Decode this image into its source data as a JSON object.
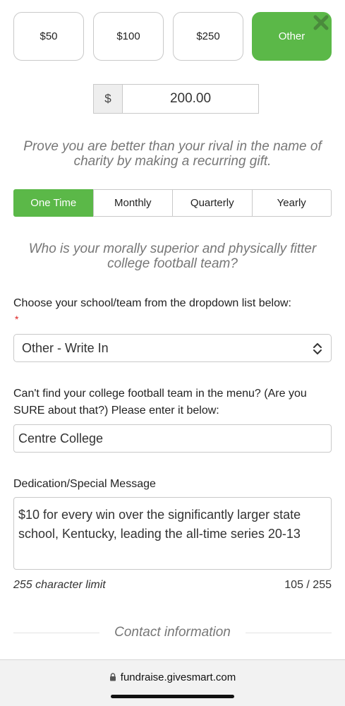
{
  "amounts": [
    {
      "label": "$50",
      "selected": false
    },
    {
      "label": "$100",
      "selected": false
    },
    {
      "label": "$250",
      "selected": false
    },
    {
      "label": "Other",
      "selected": true
    }
  ],
  "custom_amount": {
    "currency": "$",
    "value": "200.00"
  },
  "recurring_prompt": "Prove you are better than your rival in the name of charity by making a recurring gift.",
  "frequency": [
    {
      "label": "One Time",
      "selected": true
    },
    {
      "label": "Monthly",
      "selected": false
    },
    {
      "label": "Quarterly",
      "selected": false
    },
    {
      "label": "Yearly",
      "selected": false
    }
  ],
  "team_prompt": "Who is your morally superior and physically fitter college football team?",
  "school": {
    "label": "Choose your school/team from the dropdown list below:",
    "required_mark": "*",
    "selected": "Other - Write In"
  },
  "write_in": {
    "label": "Can't find your college football team in the menu? (Are you SURE about that?) Please enter it below:",
    "value": "Centre College"
  },
  "dedication": {
    "label": "Dedication/Special Message",
    "value": "$10 for every win over the significantly larger state school, Kentucky, leading the all-time series 20-13",
    "limit_text": "255 character limit",
    "count_text": "105 / 255"
  },
  "section_heading": "Contact information",
  "browser": {
    "url": "fundraise.givesmart.com"
  },
  "colors": {
    "accent": "#5bb848",
    "border": "#c9c9c9",
    "muted_text": "#777777"
  }
}
